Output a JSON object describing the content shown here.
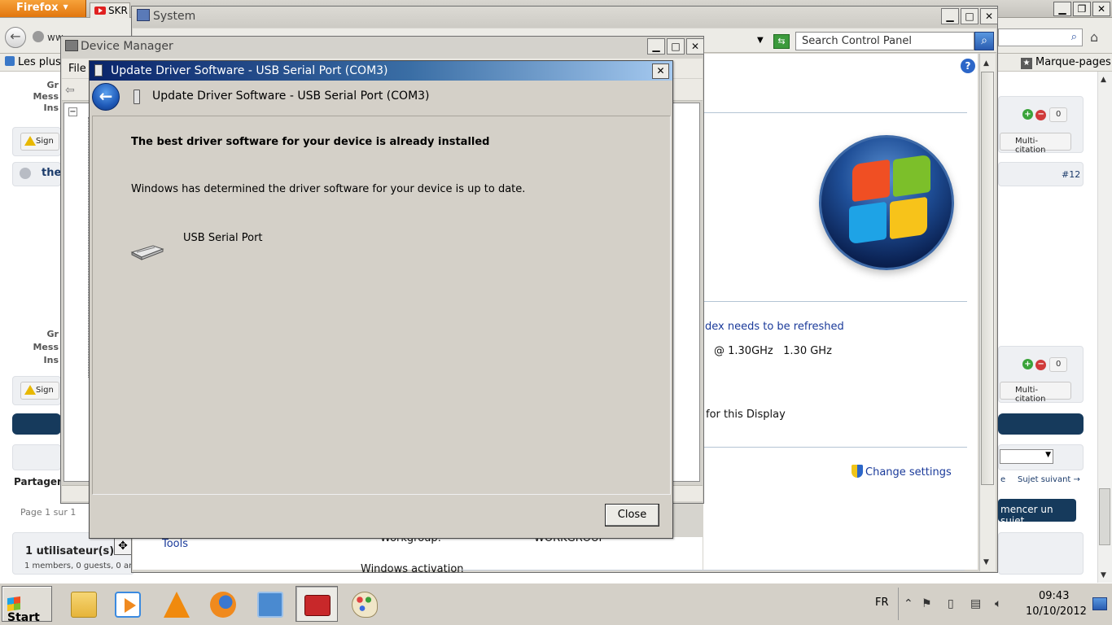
{
  "firefox": {
    "menu_label": "Firefox",
    "tab_label": "SKR",
    "url_text": "ww",
    "bookmarks_left": "Les plus",
    "bookmarks_right": "Marque-pages",
    "forum": {
      "user_labels_1": [
        "Gr",
        "Mess",
        "Ins"
      ],
      "user_labels_2": [
        "Gr",
        "Mess",
        "Ins"
      ],
      "signal_label": "Sign",
      "post_author": "the",
      "vote_count": "0",
      "multi_quote": "Multi-citation",
      "post_number": "#12",
      "share_label": "Partager",
      "page_label": "Page 1 sur 1",
      "next_topic": "Sujet suivant →",
      "next_topic_prefix": "e",
      "new_topic_btn": "mencer un sujet",
      "users_count": "1 utilisateur(s)",
      "users_detail": "1 members, 0 guests, 0 an"
    }
  },
  "system_window": {
    "title": "System",
    "search_placeholder": "Search Control Panel",
    "index_link": "dex needs to be refreshed",
    "processor": "@ 1.30GHz   1.30 GHz",
    "processor_prefix": ")",
    "display_text": "for this Display",
    "change_settings": "Change settings",
    "tools_label": "Tools",
    "workgroup_label": "Workgroup:",
    "workgroup_value": "WORKGROUP",
    "activation_label": "Windows activation"
  },
  "device_manager": {
    "title": "Device Manager",
    "menu_file": "File"
  },
  "update_dialog": {
    "title": "Update Driver Software - USB Serial Port (COM3)",
    "header_text": "Update Driver Software - USB Serial Port (COM3)",
    "heading": "The best driver software for your device is already installed",
    "message": "Windows has determined the driver software for your device is up to date.",
    "device_name": "USB Serial Port",
    "close_button": "Close"
  },
  "taskbar": {
    "start_label": "Start",
    "language": "FR",
    "time": "09:43",
    "date": "10/10/2012"
  },
  "colors": {
    "dialog_title_start": "#0a246a",
    "dialog_title_end": "#a6caf0",
    "forum_dark_bar": "#163a5c",
    "link": "#1a3a9a"
  }
}
